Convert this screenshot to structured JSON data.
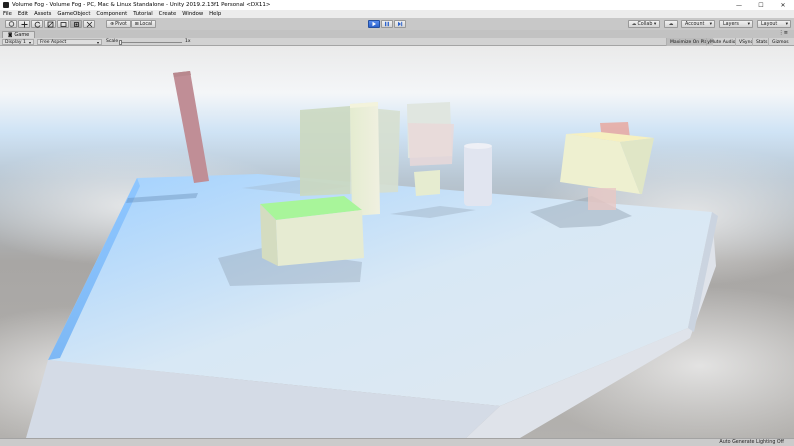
{
  "window": {
    "title": "Volume Fog - Volume Fog - PC, Mac & Linux Standalone - Unity 2019.2.13f1 Personal <DX11>",
    "minimize": "—",
    "maximize": "☐",
    "close": "✕"
  },
  "menu": [
    "File",
    "Edit",
    "Assets",
    "GameObject",
    "Component",
    "Tutorial",
    "Create",
    "Window",
    "Help"
  ],
  "toolbar": {
    "pivot_label": "Pivot",
    "local_label": "Local",
    "play_icon": "play-icon",
    "pause_icon": "pause-icon",
    "step_icon": "step-icon",
    "collab_label": "Collab ▾",
    "account_label": "Account",
    "layers_label": "Layers",
    "layout_label": "Layout"
  },
  "game_tab": {
    "label": "Game"
  },
  "game_toolbar": {
    "display": "Display 1",
    "aspect": "Free Aspect",
    "scale_label": "Scale",
    "scale_value": "1x",
    "maximize_on_play": "Maximize On Play",
    "mute_audio": "Mute Audio",
    "vsync": "VSync",
    "stats": "Stats",
    "gizmos": "Gizmos"
  },
  "status": {
    "text": "Auto Generate Lighting Off"
  },
  "colors": {
    "play_active": "#2b62cc",
    "fog_sky": "#cfe3f5",
    "platform_left_face": "#7db8f5",
    "green_cube_top": "#a8f59a"
  }
}
